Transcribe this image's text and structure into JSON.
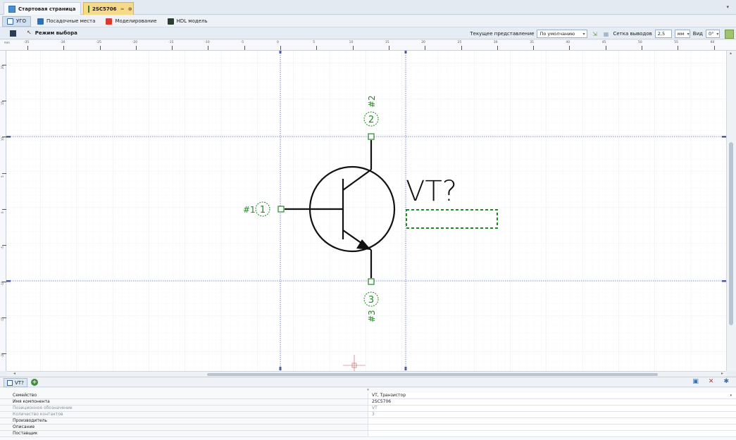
{
  "doc_tabs": {
    "start_page": "Стартовая страница",
    "component_tab": "2SC5706",
    "pin_icon": "pin-icon",
    "close_icon": "close-icon"
  },
  "mode_tabs": {
    "ugo": "УГО",
    "footprints": "Посадочные места",
    "simulation": "Моделирование",
    "hdl": "HDL модель"
  },
  "toolbar": {
    "mode_label": "Режим выбора",
    "view_label": "Текущее представление",
    "view_value": "По умолчанию",
    "grid_label": "Сетка выводов",
    "grid_value": "2,5",
    "unit_value": "мм",
    "vid_label": "Вид",
    "angle_value": "0°"
  },
  "ruler": {
    "unit": "mm",
    "x_ticks": [
      "-35",
      "-30",
      "-25",
      "-20",
      "-15",
      "-10",
      "-5",
      "0",
      "5",
      "10",
      "15",
      "20",
      "25",
      "30",
      "35",
      "40",
      "45",
      "50",
      "55",
      "60"
    ],
    "y_ticks": [
      "20",
      "15",
      "10",
      "5",
      "0",
      "-5",
      "-10",
      "-15",
      "-20"
    ]
  },
  "symbol": {
    "designator": "VT?",
    "pins": [
      {
        "name": "#1",
        "number": "1"
      },
      {
        "name": "#2",
        "number": "2"
      },
      {
        "name": "#3",
        "number": "3"
      }
    ]
  },
  "bottom": {
    "tab_label": "VT?",
    "tab_icon": "ugo-icon",
    "add_icon": "add-icon",
    "copy_icon": "copy-icon",
    "delete_icon": "delete-icon",
    "settings_icon": "gear-icon"
  },
  "properties": [
    {
      "name": "Семейство",
      "value": "VT, Транзистор",
      "muted": false
    },
    {
      "name": "Имя компонента",
      "value": "2SC5706",
      "muted": false
    },
    {
      "name": "Позиционное обозначение",
      "value": "VT",
      "muted": true
    },
    {
      "name": "Количество контактов",
      "value": "3",
      "muted": true
    },
    {
      "name": "Производитель",
      "value": "",
      "muted": false
    },
    {
      "name": "Описание",
      "value": "",
      "muted": false
    },
    {
      "name": "Поставщик",
      "value": "",
      "muted": false
    }
  ],
  "colors": {
    "pin_green": "#1f8a1f",
    "symbol_black": "#111111",
    "guide_blue": "#5b6bc0",
    "grid": "#eef0f4"
  }
}
